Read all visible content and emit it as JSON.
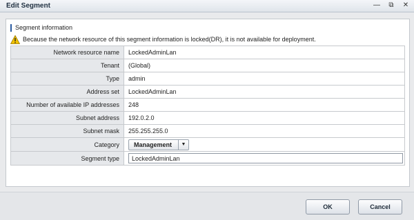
{
  "window": {
    "title": "Edit Segment",
    "controls": [
      "minimize-icon",
      "restore-icon",
      "close-icon"
    ]
  },
  "section": {
    "title": "Segment information",
    "warning": "Because the network resource of this segment information is locked(DR), it is not available for deployment."
  },
  "fields": [
    {
      "label": "Network resource name",
      "value": "LockedAdminLan"
    },
    {
      "label": "Tenant",
      "value": "(Global)"
    },
    {
      "label": "Type",
      "value": "admin"
    },
    {
      "label": "Address set",
      "value": "LockedAdminLan"
    },
    {
      "label": "Number of available IP addresses",
      "value": "248"
    },
    {
      "label": "Subnet address",
      "value": "192.0.2.0"
    },
    {
      "label": "Subnet mask",
      "value": "255.255.255.0"
    }
  ],
  "category": {
    "label": "Category",
    "selected": "Management"
  },
  "segment_type": {
    "label": "Segment type",
    "value": "LockedAdminLan"
  },
  "buttons": {
    "ok": "OK",
    "cancel": "Cancel"
  },
  "colors": {
    "warning": "#f2c200",
    "accent": "#2a5aa0"
  }
}
